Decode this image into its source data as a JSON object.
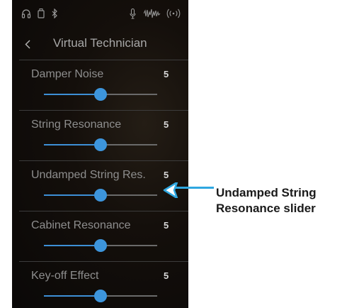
{
  "status_bar": {
    "icons": [
      "headphones-icon",
      "usb-icon",
      "bluetooth-icon",
      "microphone-icon",
      "audio-waveform-icon",
      "wireless-icon"
    ]
  },
  "header": {
    "back_icon": "chevron-left-icon",
    "title": "Virtual Technician"
  },
  "settings": [
    {
      "label": "Damper Noise",
      "value": "5",
      "level": 0.5
    },
    {
      "label": "String Resonance",
      "value": "5",
      "level": 0.5
    },
    {
      "label": "Undamped String Res.",
      "value": "5",
      "level": 0.5
    },
    {
      "label": "Cabinet Resonance",
      "value": "5",
      "level": 0.5
    },
    {
      "label": "Key-off Effect",
      "value": "5",
      "level": 0.5
    }
  ],
  "callout": {
    "line1": "Undamped String",
    "line2": "Resonance slider",
    "arrow_color": "#2fa7e0"
  },
  "colors": {
    "accent": "#3d95dc",
    "text_muted": "#8e8e8e",
    "value_text": "#d8d8d8"
  }
}
